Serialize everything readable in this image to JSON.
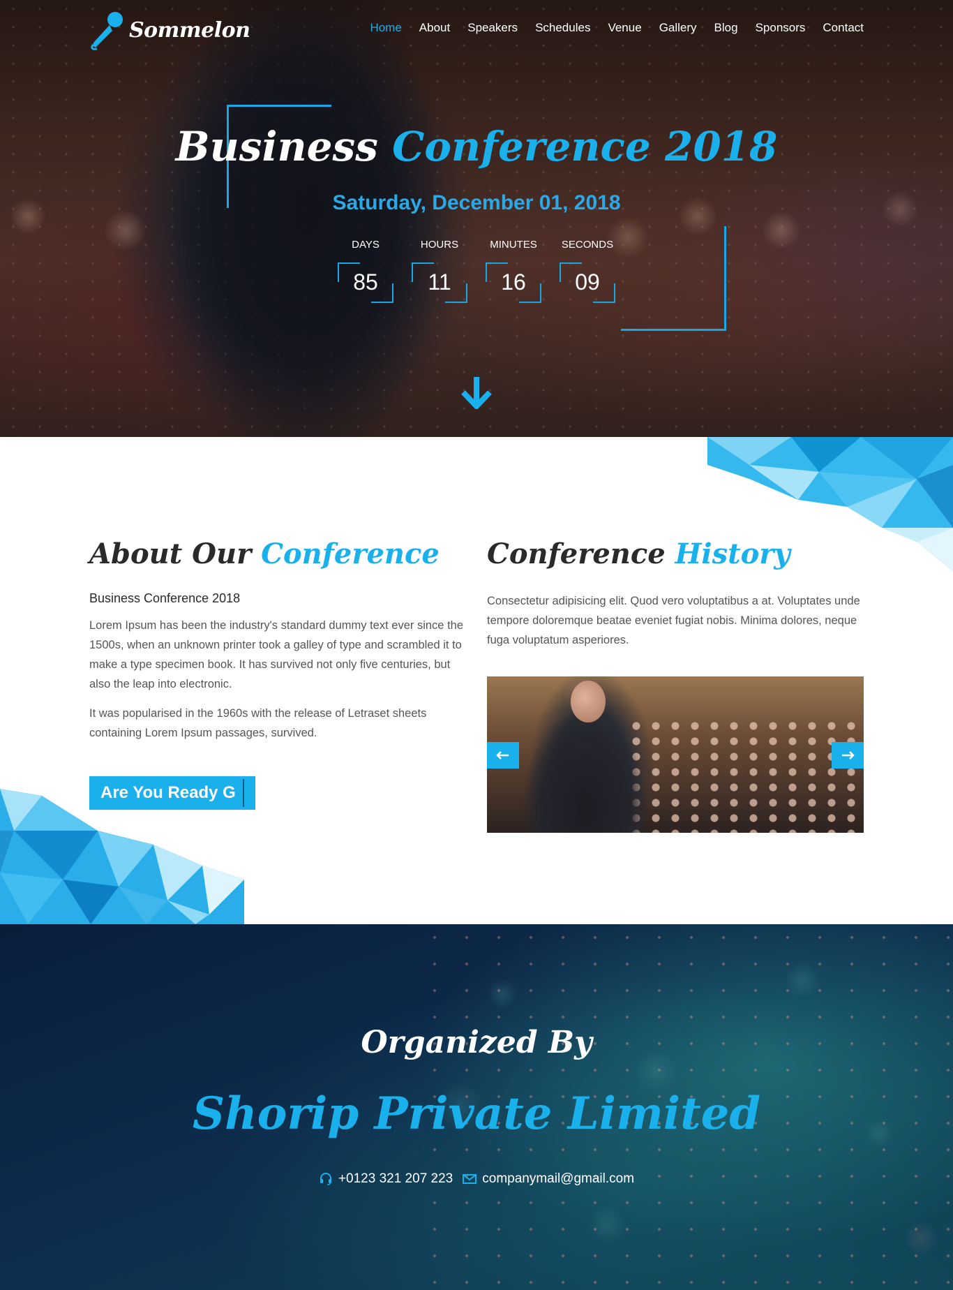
{
  "brand": {
    "name": "Sommelon",
    "accent": "#1ab0ec"
  },
  "nav": {
    "items": [
      {
        "label": "Home",
        "active": true
      },
      {
        "label": "About"
      },
      {
        "label": "Speakers"
      },
      {
        "label": "Schedules"
      },
      {
        "label": "Venue"
      },
      {
        "label": "Gallery"
      },
      {
        "label": "Blog"
      },
      {
        "label": "Sponsors"
      },
      {
        "label": "Contact"
      }
    ]
  },
  "hero": {
    "title_main": "Business",
    "title_accent": "Conference 2018",
    "date": "Saturday, December 01, 2018",
    "countdown": [
      {
        "label": "DAYS",
        "value": "85"
      },
      {
        "label": "HOURS",
        "value": "11"
      },
      {
        "label": "MINUTES",
        "value": "16"
      },
      {
        "label": "SECONDS",
        "value": "09"
      }
    ],
    "scroll_icon": "arrow-down-icon"
  },
  "about": {
    "title_main": "About Our",
    "title_accent": "Conference",
    "subtitle": "Business Conference 2018",
    "para1": "Lorem Ipsum has been the industry's standard dummy text ever since the 1500s, when an unknown printer took a galley of type and scrambled it to make a type specimen book. It has survived not only five centuries, but also the leap into electronic.",
    "para2": "It was popularised in the 1960s with the release of Letraset sheets containing Lorem Ipsum passages, survived.",
    "cta_label": "Are You Ready G"
  },
  "history": {
    "title_main": "Conference",
    "title_accent": "History",
    "text": "Consectetur adipisicing elit. Quod vero voluptatibus a at. Voluptates unde tempore doloremque beatae eveniet fugiat nobis. Minima dolores, neque fuga voluptatum asperiores.",
    "prev_icon": "arrow-left-icon",
    "next_icon": "arrow-right-icon"
  },
  "organizer": {
    "label": "Organized By",
    "name": "Shorip Private Limited",
    "phone": "+0123 321 207 223",
    "email": "companymail@gmail.com"
  }
}
